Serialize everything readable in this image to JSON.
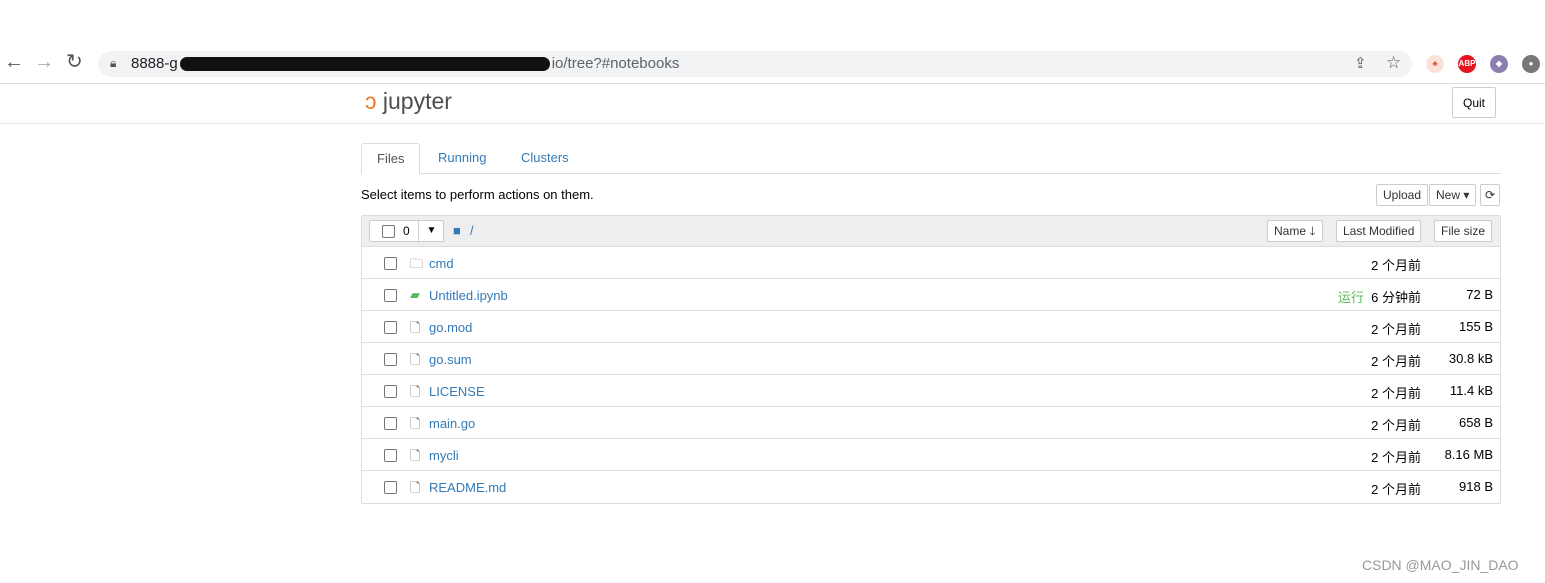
{
  "browser": {
    "url_visible_start": "8888-g",
    "url_visible_end": "io/tree?#notebooks"
  },
  "header": {
    "logo": "jupyter",
    "quit": "Quit"
  },
  "tabs": [
    {
      "label": "Files"
    },
    {
      "label": "Running"
    },
    {
      "label": "Clusters"
    }
  ],
  "toolbar": {
    "hint": "Select items to perform actions on them.",
    "upload": "Upload",
    "new": "New",
    "selected_count": "0",
    "path": "/"
  },
  "columns": {
    "name": "Name",
    "modified": "Last Modified",
    "size": "File size"
  },
  "files": [
    {
      "name": "cmd",
      "type": "folder",
      "modified": "2 个月前",
      "size": ""
    },
    {
      "name": "Untitled.ipynb",
      "type": "notebook",
      "status": "运行",
      "modified": "6 分钟前",
      "size": "72 B"
    },
    {
      "name": "go.mod",
      "type": "file",
      "modified": "2 个月前",
      "size": "155 B"
    },
    {
      "name": "go.sum",
      "type": "file",
      "modified": "2 个月前",
      "size": "30.8 kB"
    },
    {
      "name": "LICENSE",
      "type": "file",
      "modified": "2 个月前",
      "size": "11.4 kB"
    },
    {
      "name": "main.go",
      "type": "file",
      "modified": "2 个月前",
      "size": "658 B"
    },
    {
      "name": "mycli",
      "type": "file",
      "modified": "2 个月前",
      "size": "8.16 MB"
    },
    {
      "name": "README.md",
      "type": "file",
      "modified": "2 个月前",
      "size": "918 B"
    }
  ],
  "watermark": "CSDN @MAO_JIN_DAO",
  "colors": {
    "link": "#337ab7",
    "running": "#5cb85c",
    "logo_orange": "#f37726"
  }
}
